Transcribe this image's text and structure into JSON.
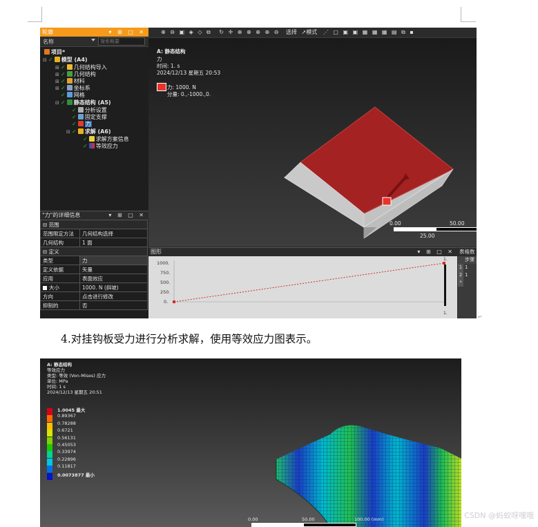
{
  "screenshot1": {
    "outline": {
      "title": "轮廓",
      "panel_buttons": "▾ ⊞ □ ✕",
      "name_column": "名称",
      "search_placeholder": "搜索概要",
      "tree": {
        "project": "项目*",
        "model": "模型 (A4)",
        "geometry_import": "几何结构导入",
        "geometry": "几何结构",
        "materials": "材料",
        "coordinate_systems": "坐标系",
        "mesh": "网格",
        "static_structural": "静态结构 (A5)",
        "analysis_settings": "分析设置",
        "fixed_support": "固定支撑",
        "force": "力",
        "solution": "求解 (A6)",
        "solution_information": "求解方案信息",
        "equivalent_stress": "等效应力"
      }
    },
    "details": {
      "title": "\"力\"的详细信息",
      "panel_buttons": "▾ ⊞ □ ✕",
      "sections": [
        {
          "name": "范围",
          "rows": [
            [
              "范围限定方法",
              "几何结构选择"
            ],
            [
              "几何结构",
              "1 面"
            ]
          ]
        },
        {
          "name": "定义",
          "rows": [
            [
              "类型",
              "力"
            ],
            [
              "定义依据",
              "矢量"
            ],
            [
              "应用",
              "表面效应"
            ],
            [
              "大小",
              "1000. N  (斜坡)"
            ],
            [
              "方向",
              "点击进行修改"
            ],
            [
              "抑制的",
              "否"
            ]
          ]
        }
      ]
    },
    "toolbar": {
      "select_label": "选择",
      "mode_label": "模式"
    },
    "viewport": {
      "analysis_title": "A: 静态结构",
      "load_name": "力",
      "time_text": "时间: 1. s",
      "date_text": "2024/12/13 星期五 20:53",
      "legend_label": "力: 1000. N",
      "legend_components": "分量: 0.,-1000.,0.",
      "scale_left": "0.00",
      "scale_right": "50.00",
      "scale_mid": "25.00",
      "colors": {
        "face": "#a52222",
        "side": "#d0d0d0",
        "marker": "#e8332a"
      }
    },
    "graph": {
      "title": "图形",
      "panel_buttons": "▾ ⊞ □ ✕",
      "y_ticks": [
        "1000.",
        "750.",
        "500.",
        "250.",
        "0."
      ],
      "right_top": "1.",
      "right_bottom": "1.",
      "series_color": "#d42a2a"
    },
    "table_panel": {
      "title": "表格数",
      "header": "步骤",
      "rows": [
        [
          "1",
          "1"
        ],
        [
          "2",
          "1"
        ],
        [
          "*",
          ""
        ]
      ]
    }
  },
  "caption": "4.对挂钩板受力进行分析求解，使用等效应力图表示。",
  "screenshot2": {
    "info": [
      "A: 静态结构",
      "等效应力",
      "类型: 等效 (Von-Mises) 应力",
      "单位: MPa",
      "时间: 1 s",
      "2024/12/13 星期五 20:51"
    ],
    "legend": [
      {
        "label": "1.0045 最大",
        "color": "#d9001b",
        "bold": true
      },
      {
        "label": "0.89367",
        "color": "#ff6a00"
      },
      {
        "label": "0.78288",
        "color": "#ffc000"
      },
      {
        "label": "0.6721",
        "color": "#d8e600"
      },
      {
        "label": "0.56131",
        "color": "#7ed400"
      },
      {
        "label": "0.45053",
        "color": "#1ec800"
      },
      {
        "label": "0.33974",
        "color": "#00d29a"
      },
      {
        "label": "0.22896",
        "color": "#00c8e0"
      },
      {
        "label": "0.11817",
        "color": "#0070e6"
      },
      {
        "label": "0.0073877 最小",
        "color": "#0014c8",
        "bold": true
      }
    ],
    "scale_labels": [
      "0.00",
      "50.00",
      "100.00 (mm)"
    ]
  },
  "watermark": "CSDN @蚂蚁呀嘿哦"
}
